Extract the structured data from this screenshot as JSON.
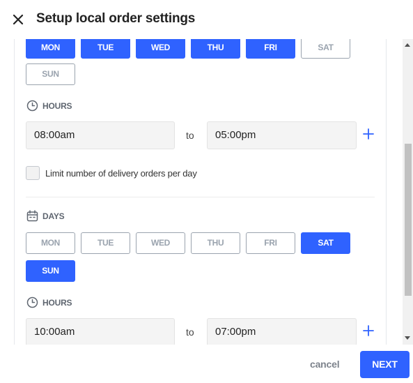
{
  "header": {
    "title": "Setup local order settings"
  },
  "section1": {
    "days": [
      {
        "label": "MON",
        "selected": true
      },
      {
        "label": "TUE",
        "selected": true
      },
      {
        "label": "WED",
        "selected": true
      },
      {
        "label": "THU",
        "selected": true
      },
      {
        "label": "FRI",
        "selected": true
      },
      {
        "label": "SAT",
        "selected": false
      },
      {
        "label": "SUN",
        "selected": false
      }
    ],
    "hours_label": "HOURS",
    "from_time": "08:00am",
    "to_label": "to",
    "to_time": "05:00pm"
  },
  "limit_checkbox": {
    "label": "Limit number of delivery orders per day",
    "checked": false
  },
  "section2": {
    "days_label": "DAYS",
    "days": [
      {
        "label": "MON",
        "selected": false
      },
      {
        "label": "TUE",
        "selected": false
      },
      {
        "label": "WED",
        "selected": false
      },
      {
        "label": "THU",
        "selected": false
      },
      {
        "label": "FRI",
        "selected": false
      },
      {
        "label": "SAT",
        "selected": true
      },
      {
        "label": "SUN",
        "selected": true
      }
    ],
    "hours_label": "HOURS",
    "from_time": "10:00am",
    "to_label": "to",
    "to_time": "07:00pm"
  },
  "footer": {
    "cancel_label": "cancel",
    "next_label": "NEXT"
  },
  "colors": {
    "accent": "#2f62ff",
    "inactive": "#9aa3ae"
  }
}
